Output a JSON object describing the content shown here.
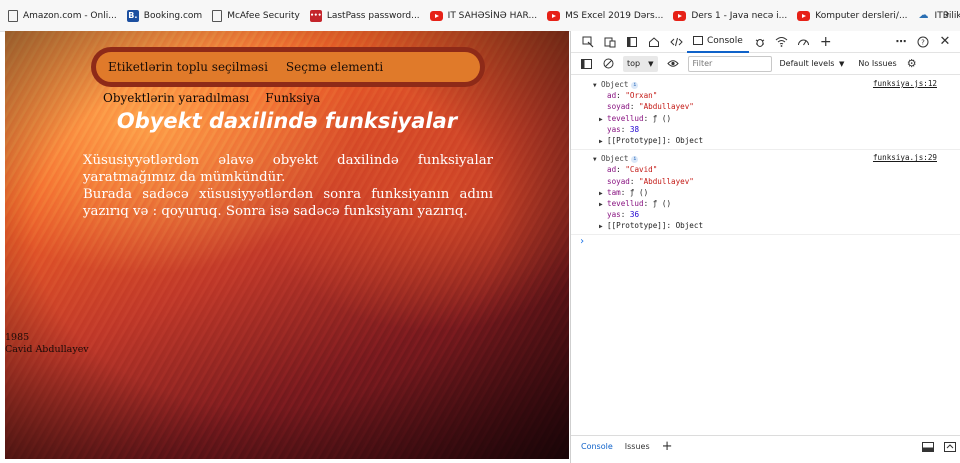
{
  "bookmarks": [
    {
      "label": "Amazon.com - Onli...",
      "icon": "page-icon"
    },
    {
      "label": "Booking.com",
      "icon": "booking-icon"
    },
    {
      "label": "McAfee Security",
      "icon": "page-icon"
    },
    {
      "label": "LastPass password...",
      "icon": "lastpass-icon"
    },
    {
      "label": "IT SAHƏSİNƏ HAR...",
      "icon": "youtube-icon"
    },
    {
      "label": "MS Excel 2019 Dərs...",
      "icon": "youtube-icon"
    },
    {
      "label": "Ders 1 - Java necə i...",
      "icon": "youtube-icon"
    },
    {
      "label": "Komputer dersleri/...",
      "icon": "youtube-icon"
    },
    {
      "label": "ITBilik.az",
      "icon": "itbilik-icon"
    }
  ],
  "page": {
    "nav_top": [
      "Etiketlərin toplu seçilməsi",
      "Seçmə elementi"
    ],
    "nav_sub": [
      "Obyektlərin yaradılması",
      "Funksiya"
    ],
    "heading": "Obyekt daxilində funksiyalar",
    "paragraphs": [
      "Xüsusiyyətlərdən əlavə obyekt daxilində funksiyalar yaratmağımız da mümkündür.",
      "Burada sadəcə xüsusiyyətlərdən sonra funksiyanın adını yazırıq və : qoyuruq. Sonra isə sadəcə funksiyanı yazırıq."
    ],
    "footer_year": "1985",
    "footer_name": "Cavid Abdullayev"
  },
  "devtools": {
    "tab_console": "Console",
    "context": "top",
    "filter_placeholder": "Filter",
    "levels": "Default levels",
    "no_issues": "No Issues",
    "messages": [
      {
        "source": "funksiya.js:12",
        "header": "Object",
        "lines": [
          {
            "key": "ad",
            "value": "\"Orxan\"",
            "type": "str"
          },
          {
            "key": "soyad",
            "value": "\"Abdullayev\"",
            "type": "str"
          },
          {
            "key": "tevellud",
            "value": "ƒ ()",
            "type": "fn",
            "expandable": true
          },
          {
            "key": "yas",
            "value": "38",
            "type": "num"
          },
          {
            "key": "[[Prototype]]",
            "value": "Object",
            "type": "proto",
            "expandable": true
          }
        ]
      },
      {
        "source": "funksiya.js:29",
        "header": "Object",
        "lines": [
          {
            "key": "ad",
            "value": "\"Cavid\"",
            "type": "str"
          },
          {
            "key": "soyad",
            "value": "\"Abdullayev\"",
            "type": "str"
          },
          {
            "key": "tam",
            "value": "ƒ ()",
            "type": "fn",
            "expandable": true
          },
          {
            "key": "tevellud",
            "value": "ƒ ()",
            "type": "fn",
            "expandable": true
          },
          {
            "key": "yas",
            "value": "36",
            "type": "num"
          },
          {
            "key": "[[Prototype]]",
            "value": "Object",
            "type": "proto",
            "expandable": true
          }
        ]
      }
    ],
    "drawer_tabs": [
      "Console",
      "Issues"
    ]
  }
}
